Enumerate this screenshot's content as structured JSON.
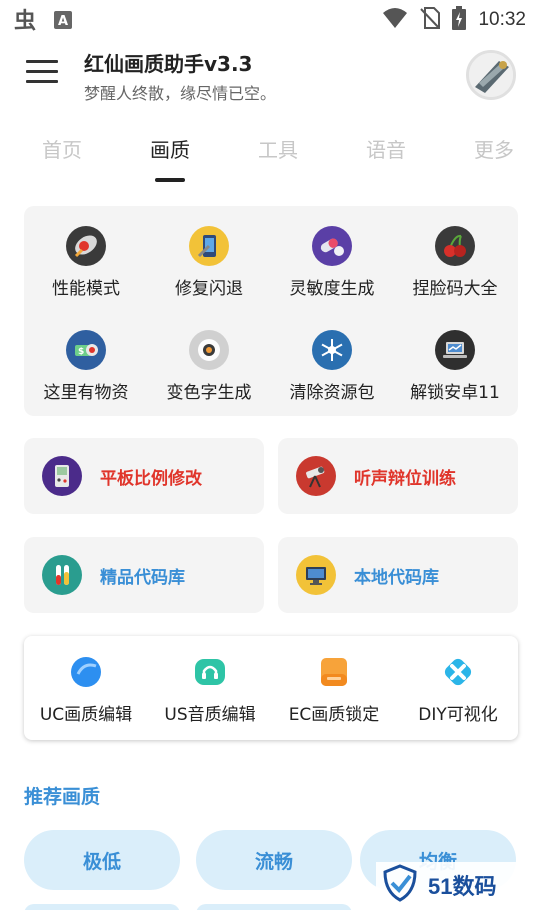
{
  "status_bar": {
    "time": "10:32",
    "left_icons": [
      "bug-icon",
      "a-icon"
    ],
    "right_icons": [
      "wifi-icon",
      "no-sim-icon",
      "battery-icon"
    ]
  },
  "header": {
    "title": "红仙画质助手v3.3",
    "subtitle": "梦醒人终散，缘尽情已空。"
  },
  "tabs": [
    {
      "label": "首页",
      "active": false
    },
    {
      "label": "画质",
      "active": true
    },
    {
      "label": "工具",
      "active": false
    },
    {
      "label": "语音",
      "active": false
    },
    {
      "label": "更多",
      "active": false
    }
  ],
  "grid": [
    {
      "label": "性能模式",
      "icon": "rocket-icon"
    },
    {
      "label": "修复闪退",
      "icon": "phone-repair-icon"
    },
    {
      "label": "灵敏度生成",
      "icon": "pills-icon"
    },
    {
      "label": "捏脸码大全",
      "icon": "cherries-icon"
    },
    {
      "label": "这里有物资",
      "icon": "money-icon"
    },
    {
      "label": "变色字生成",
      "icon": "sushi-icon"
    },
    {
      "label": "清除资源包",
      "icon": "snowflake-icon"
    },
    {
      "label": "解锁安卓11",
      "icon": "laptop-icon"
    }
  ],
  "wide_cards": [
    {
      "label": "平板比例修改",
      "icon": "gameboy-icon",
      "color": "#e0352b"
    },
    {
      "label": "听声辩位训练",
      "icon": "telescope-icon",
      "color": "#e0352b"
    },
    {
      "label": "精品代码库",
      "icon": "test-tubes-icon",
      "color": "#3a8fd6"
    },
    {
      "label": "本地代码库",
      "icon": "monitor-icon",
      "color": "#3a8fd6"
    }
  ],
  "editors": [
    {
      "label": "UC画质编辑",
      "icon": "bubble-icon"
    },
    {
      "label": "US音质编辑",
      "icon": "headphones-icon"
    },
    {
      "label": "EC画质锁定",
      "icon": "document-icon"
    },
    {
      "label": "DIY可视化",
      "icon": "diamond-x-icon"
    }
  ],
  "section_title": "推荐画质",
  "presets": [
    "极低",
    "流畅",
    "均衡"
  ],
  "watermark": "51数码",
  "colors": {
    "accent_blue": "#3a8fd6",
    "accent_red": "#e0352b",
    "pill_bg": "#daeefa",
    "card_bg": "#f4f4f4"
  }
}
